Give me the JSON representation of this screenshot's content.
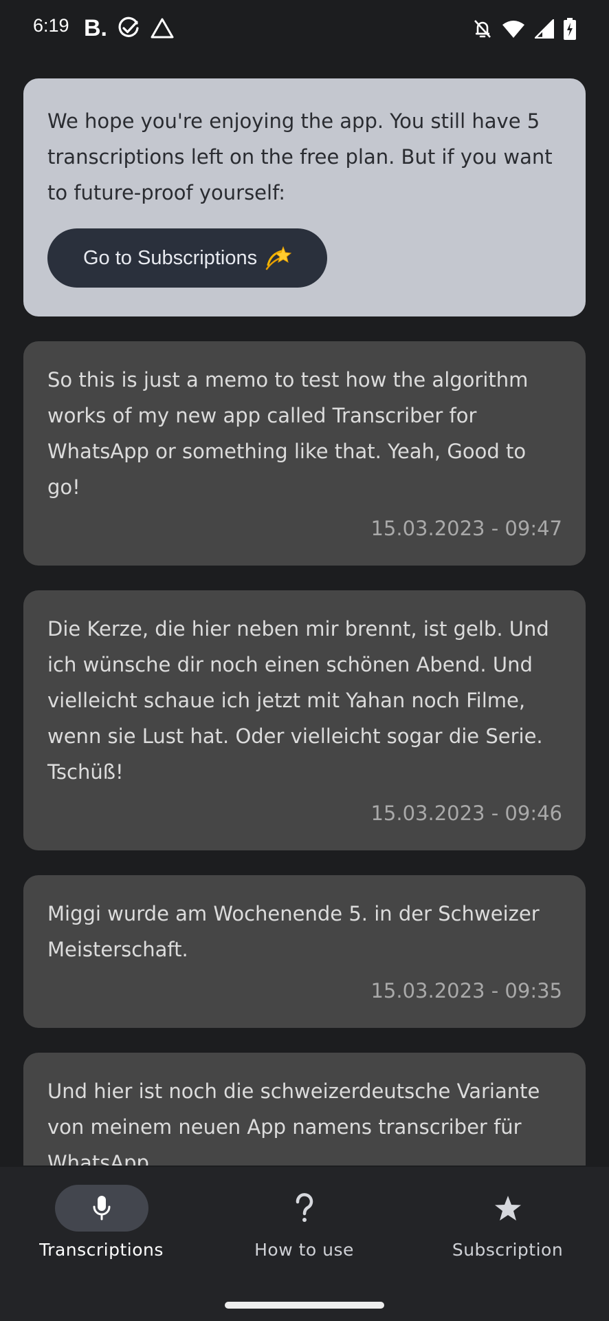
{
  "status_bar": {
    "time": "6:19",
    "left_icons": [
      "b-app-icon",
      "check-circle-icon",
      "warning-triangle-icon"
    ],
    "right_icons": [
      "bell-off-icon",
      "wifi-icon",
      "signal-icon",
      "battery-charging-icon"
    ]
  },
  "promo": {
    "text": "We hope you're enjoying the app. You still have 5 transcriptions left on the free plan. But if you want to future-proof yourself:",
    "button_label": "Go to Subscriptions",
    "button_icon": "dizzy-star-icon"
  },
  "memos": [
    {
      "text": "So this is just a memo to test how the algorithm works of my new app called Transcriber for WhatsApp or something like that. Yeah, Good to go!",
      "date": "15.03.2023 - 09:47"
    },
    {
      "text": "Die Kerze, die hier neben mir brennt, ist gelb. Und ich wünsche dir noch einen schönen Abend. Und vielleicht schaue ich jetzt mit Yahan noch Filme, wenn sie Lust hat. Oder vielleicht sogar die Serie. Tschüß!",
      "date": "15.03.2023 - 09:46"
    },
    {
      "text": "Miggi wurde am Wochenende 5. in der Schweizer Meisterschaft.",
      "date": "15.03.2023 - 09:35"
    },
    {
      "text": "Und hier ist noch die schweizerdeutsche Variante von meinem neuen App namens transcriber für WhatsApp",
      "date": ""
    }
  ],
  "bottom_nav": {
    "items": [
      {
        "label": "Transcriptions",
        "icon": "microphone-icon",
        "active": true
      },
      {
        "label": "How to use",
        "icon": "question-mark-icon",
        "active": false
      },
      {
        "label": "Subscription",
        "icon": "star-icon",
        "active": false
      }
    ]
  },
  "colors": {
    "background": "#1c1d1f",
    "promo_card": "#c4c7cf",
    "promo_button": "#2a303c",
    "memo_card": "#464646",
    "nav_bar": "#232427",
    "active_pill": "#43464e"
  }
}
